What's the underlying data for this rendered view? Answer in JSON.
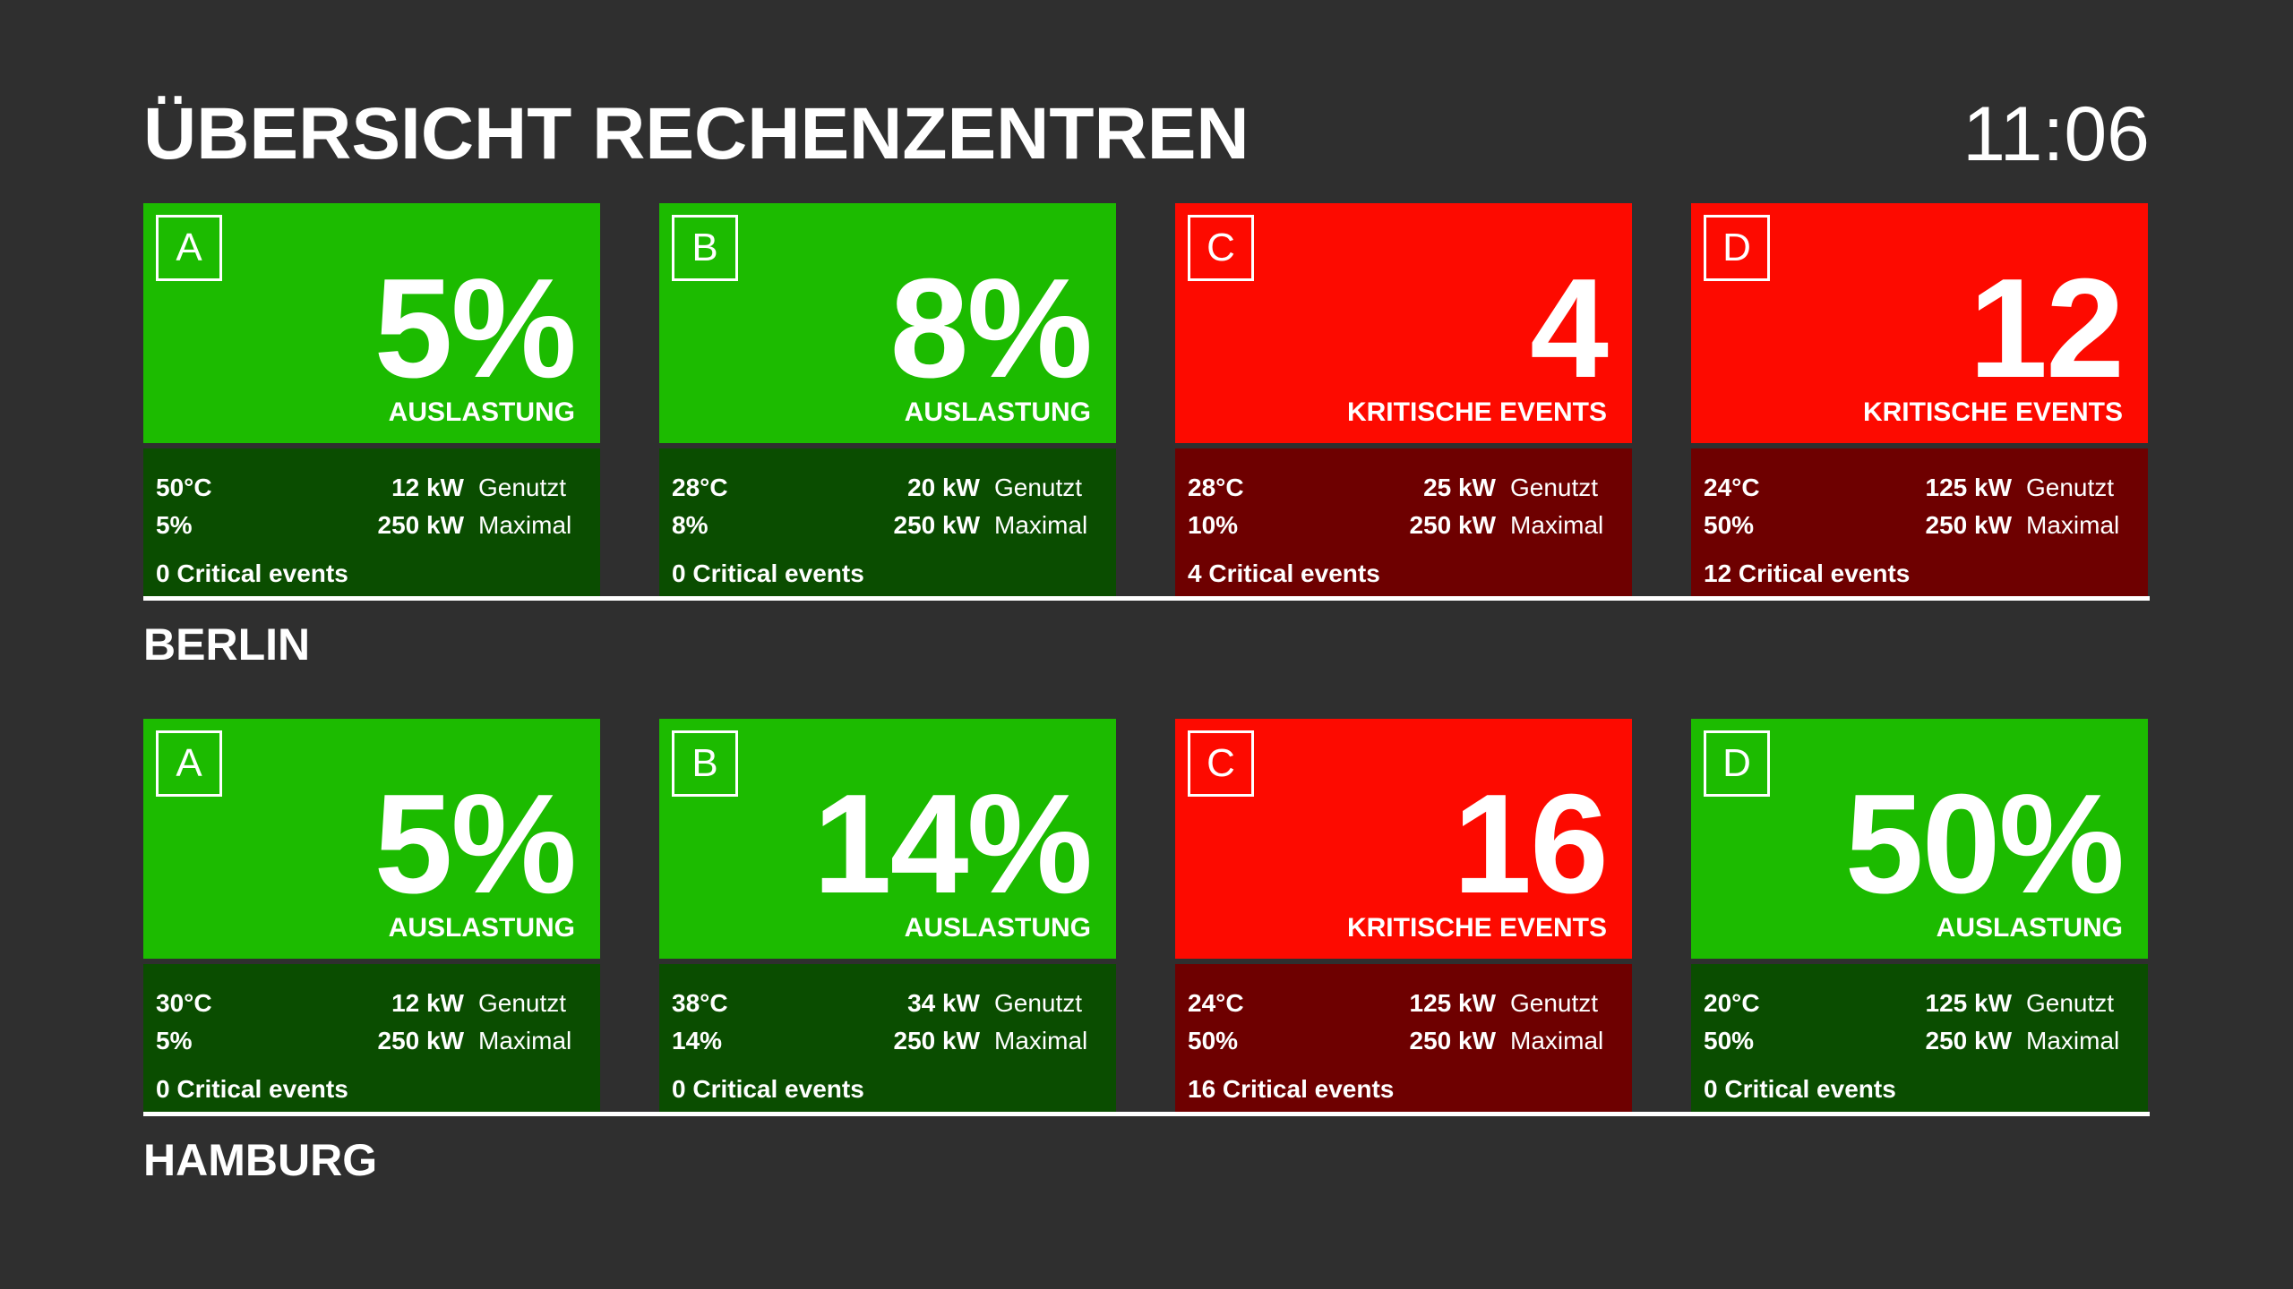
{
  "header": {
    "title": "ÜBERSICHT RECHENZENTREN",
    "clock": "11:06"
  },
  "colors": {
    "background": "#2f2f2f",
    "ok_top": "#1cbb00",
    "ok_bottom": "#0a4d00",
    "alert_top": "#fd0a00",
    "alert_bottom": "#6e0000",
    "text": "#ffffff"
  },
  "regions": [
    {
      "name": "BERLIN",
      "cards": [
        {
          "letter": "A",
          "status": "ok",
          "value": "5%",
          "value_label": "AUSLASTUNG",
          "temp": "50°C",
          "pct": "5%",
          "used_kw": "12 kW",
          "used_label": "Genutzt",
          "max_kw": "250 kW",
          "max_label": "Maximal",
          "events": "0 Critical events"
        },
        {
          "letter": "B",
          "status": "ok",
          "value": "8%",
          "value_label": "AUSLASTUNG",
          "temp": "28°C",
          "pct": "8%",
          "used_kw": "20 kW",
          "used_label": "Genutzt",
          "max_kw": "250 kW",
          "max_label": "Maximal",
          "events": "0 Critical events"
        },
        {
          "letter": "C",
          "status": "alert",
          "value": "4",
          "value_label": "KRITISCHE EVENTS",
          "temp": "28°C",
          "pct": "10%",
          "used_kw": "25 kW",
          "used_label": "Genutzt",
          "max_kw": "250 kW",
          "max_label": "Maximal",
          "events": "4 Critical events"
        },
        {
          "letter": "D",
          "status": "alert",
          "value": "12",
          "value_label": "KRITISCHE EVENTS",
          "temp": "24°C",
          "pct": "50%",
          "used_kw": "125 kW",
          "used_label": "Genutzt",
          "max_kw": "250 kW",
          "max_label": "Maximal",
          "events": "12 Critical events"
        }
      ]
    },
    {
      "name": "HAMBURG",
      "cards": [
        {
          "letter": "A",
          "status": "ok",
          "value": "5%",
          "value_label": "AUSLASTUNG",
          "temp": "30°C",
          "pct": "5%",
          "used_kw": "12 kW",
          "used_label": "Genutzt",
          "max_kw": "250 kW",
          "max_label": "Maximal",
          "events": "0 Critical events"
        },
        {
          "letter": "B",
          "status": "ok",
          "value": "14%",
          "value_label": "AUSLASTUNG",
          "temp": "38°C",
          "pct": "14%",
          "used_kw": "34 kW",
          "used_label": "Genutzt",
          "max_kw": "250 kW",
          "max_label": "Maximal",
          "events": "0 Critical events"
        },
        {
          "letter": "C",
          "status": "alert",
          "value": "16",
          "value_label": "KRITISCHE EVENTS",
          "temp": "24°C",
          "pct": "50%",
          "used_kw": "125 kW",
          "used_label": "Genutzt",
          "max_kw": "250 kW",
          "max_label": "Maximal",
          "events": "16 Critical events"
        },
        {
          "letter": "D",
          "status": "ok",
          "value": "50%",
          "value_label": "AUSLASTUNG",
          "temp": "20°C",
          "pct": "50%",
          "used_kw": "125 kW",
          "used_label": "Genutzt",
          "max_kw": "250 kW",
          "max_label": "Maximal",
          "events": "0 Critical events"
        }
      ]
    }
  ]
}
